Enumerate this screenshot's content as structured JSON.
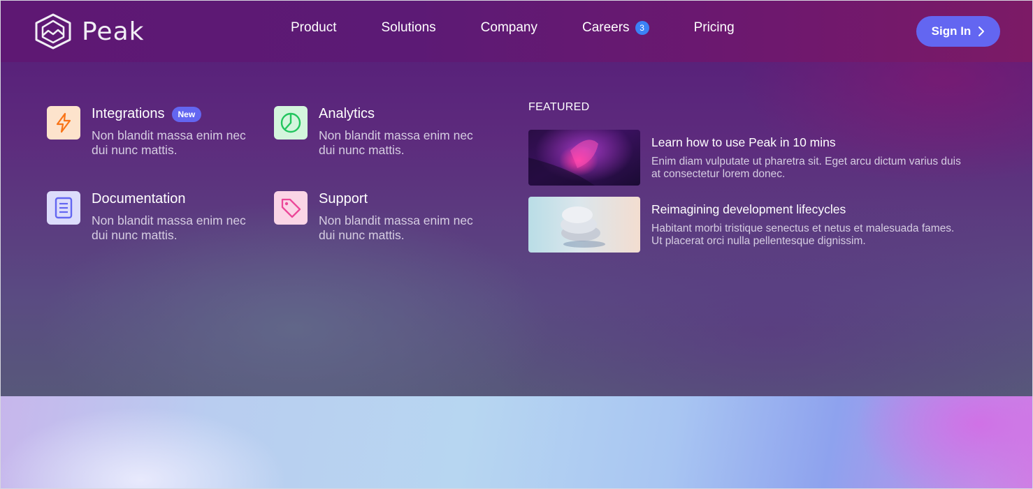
{
  "brand": {
    "name": "Peak"
  },
  "nav": {
    "links": [
      {
        "label": "Product"
      },
      {
        "label": "Solutions"
      },
      {
        "label": "Company"
      },
      {
        "label": "Careers",
        "badge": "3"
      },
      {
        "label": "Pricing"
      }
    ],
    "signin_label": "Sign In"
  },
  "menu": {
    "items": [
      {
        "title": "Integrations",
        "badge": "New",
        "desc": "Non blandit massa enim nec dui nunc mattis.",
        "icon": "lightning-icon",
        "icon_bg": "#fde3cc",
        "icon_color": "#f97316"
      },
      {
        "title": "Analytics",
        "desc": "Non blandit massa enim nec dui nunc mattis.",
        "icon": "pie-chart-icon",
        "icon_bg": "#d4f5dd",
        "icon_color": "#22c55e"
      },
      {
        "title": "Documentation",
        "desc": "Non blandit massa enim nec dui nunc mattis.",
        "icon": "book-icon",
        "icon_bg": "#dcdcfb",
        "icon_color": "#6366f1"
      },
      {
        "title": "Support",
        "desc": "Non blandit massa enim nec dui nunc mattis.",
        "icon": "tag-icon",
        "icon_bg": "#fbd5e6",
        "icon_color": "#ec4899"
      }
    ]
  },
  "featured": {
    "label": "FEATURED",
    "posts": [
      {
        "title": "Learn how to use Peak in 10 mins",
        "desc": "Enim diam vulputate ut pharetra sit. Eget arcu dictum varius duis at consectetur lorem donec."
      },
      {
        "title": "Reimagining development lifecycles",
        "desc": "Habitant morbi tristique senectus et netus et malesuada fames. Ut placerat orci nulla pellentesque dignissim."
      }
    ]
  },
  "colors": {
    "accent": "#6366f1",
    "badge_blue": "#3b82f6"
  }
}
